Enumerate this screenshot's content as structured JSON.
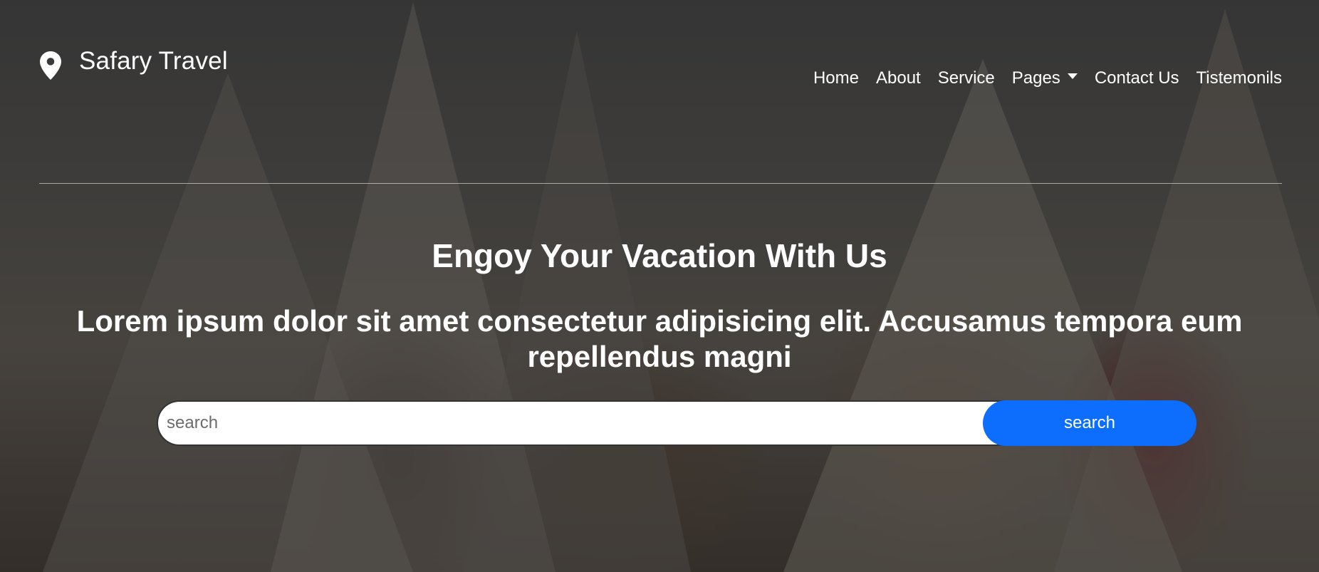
{
  "brand": {
    "name": "Safary Travel",
    "icon": "location-pin-icon"
  },
  "nav": {
    "items": [
      {
        "label": "Home"
      },
      {
        "label": "About"
      },
      {
        "label": "Service"
      },
      {
        "label": "Pages",
        "dropdown": true
      },
      {
        "label": "Contact Us"
      },
      {
        "label": "Tistemonils"
      }
    ]
  },
  "hero": {
    "headline": "Engoy Your Vacation With Us",
    "subhead": "Lorem ipsum dolor sit amet consectetur adipisicing elit. Accusamus tempora eum repellendus magni"
  },
  "search": {
    "placeholder": "search",
    "value": "",
    "button_label": "search"
  },
  "colors": {
    "accent": "#0d6efd",
    "text": "#ffffff"
  }
}
